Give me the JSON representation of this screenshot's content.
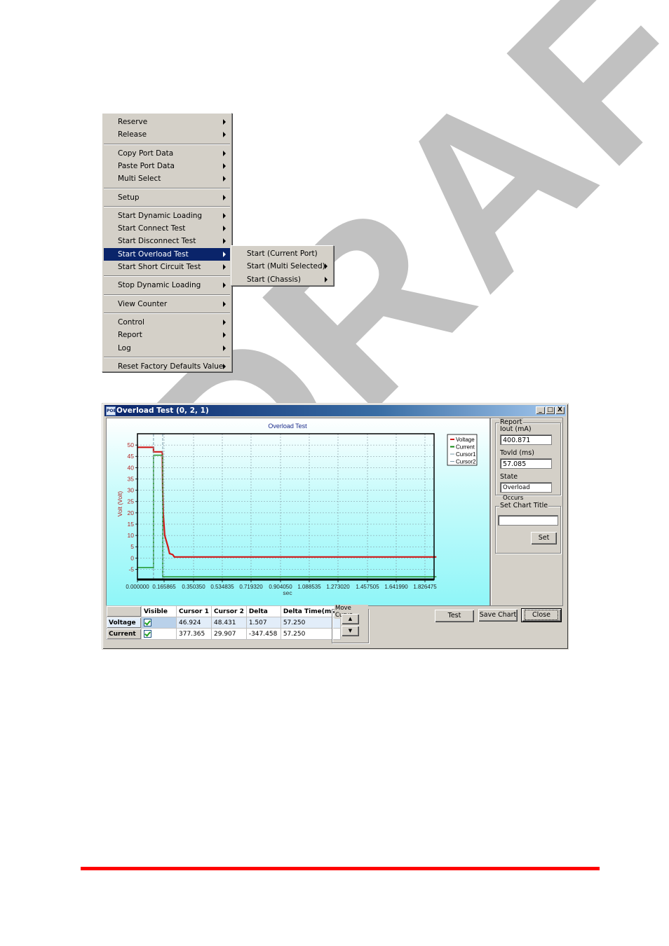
{
  "context_menu": {
    "items": [
      {
        "label": "Reserve",
        "has_submenu": true
      },
      {
        "label": "Release",
        "has_submenu": true
      },
      {
        "separator": true
      },
      {
        "label": "Copy Port Data",
        "has_submenu": true
      },
      {
        "label": "Paste Port Data",
        "has_submenu": true
      },
      {
        "label": "Multi Select",
        "has_submenu": true
      },
      {
        "separator": true
      },
      {
        "label": "Setup",
        "has_submenu": true
      },
      {
        "separator": true
      },
      {
        "label": "Start Dynamic Loading",
        "has_submenu": true
      },
      {
        "label": "Start Connect Test",
        "has_submenu": true
      },
      {
        "label": "Start Disconnect Test",
        "has_submenu": true
      },
      {
        "label": "Start Overload Test",
        "has_submenu": true,
        "active": true
      },
      {
        "label": "Start Short Circuit Test",
        "has_submenu": true
      },
      {
        "separator": true
      },
      {
        "label": "Stop Dynamic Loading",
        "has_submenu": true
      },
      {
        "separator": true
      },
      {
        "label": "View Counter",
        "has_submenu": true
      },
      {
        "separator": true
      },
      {
        "label": "Control",
        "has_submenu": true
      },
      {
        "label": "Report",
        "has_submenu": true
      },
      {
        "label": "Log",
        "has_submenu": true
      },
      {
        "separator": true
      },
      {
        "label": "Reset Factory Defaults Value",
        "has_submenu": true
      }
    ],
    "submenu": [
      {
        "label": "Start (Current Port)",
        "has_submenu": false
      },
      {
        "label": "Start (Multi Selected)",
        "has_submenu": true
      },
      {
        "label": "Start (Chassis)",
        "has_submenu": true
      }
    ]
  },
  "window": {
    "title": "Overload Test (0, 2, 1)",
    "app_icon_text": "POE",
    "controls": {
      "minimize": "_",
      "maximize": "□",
      "close": "X"
    }
  },
  "chart_data": {
    "type": "line",
    "title": "Overload Test",
    "xlabel": "sec",
    "ylabel": "Volt (Volt)",
    "xlim": [
      0.0,
      1.9
    ],
    "ylim": [
      -9.5,
      55
    ],
    "grid": true,
    "legend_position": "right",
    "x_ticks": [
      "0.000000",
      "0.165865",
      "0.350350",
      "0.534835",
      "0.719320",
      "0.904050",
      "1.088535",
      "1.273020",
      "1.457505",
      "1.641990",
      "1.826475"
    ],
    "x_tick_values": [
      0.0,
      0.165865,
      0.35035,
      0.534835,
      0.71932,
      0.90405,
      1.088535,
      1.27302,
      1.457505,
      1.64199,
      1.826475
    ],
    "y_ticks": [
      50,
      45,
      40,
      35,
      30,
      25,
      20,
      15,
      10,
      5,
      0,
      -5
    ],
    "colors": {
      "voltage": "#d01818",
      "current": "#128a12",
      "cursor": "#7a9aa8",
      "grid": "#7d8f99"
    },
    "series": [
      {
        "name": "Voltage",
        "x": [
          0.0,
          0.1,
          0.1,
          0.155,
          0.157,
          0.16,
          0.17,
          0.19,
          0.2,
          0.22,
          0.23,
          1.9
        ],
        "y": [
          49,
          49,
          47,
          47,
          30,
          20,
          10,
          5,
          2,
          1.5,
          0.5,
          0.5
        ]
      },
      {
        "name": "Current",
        "x": [
          0.0,
          0.1,
          0.1,
          0.157,
          0.157,
          1.9
        ],
        "y": [
          -4.2,
          -4.2,
          45.5,
          45.5,
          -8.3,
          -8.3
        ]
      },
      {
        "name": "Cursor1",
        "x": [
          0.1,
          0.1
        ],
        "y": [
          -9.5,
          55
        ]
      },
      {
        "name": "Cursor2",
        "x": [
          0.157,
          0.157
        ],
        "y": [
          -9.5,
          55
        ]
      }
    ]
  },
  "report": {
    "group_label": "Report",
    "iout_label": "Iout (mA)",
    "iout_value": "400.871",
    "tovld_label": "Tovld (ms)",
    "tovld_value": "57.085",
    "state_label": "State",
    "state_value": "Overload Occurs"
  },
  "chart_title_group": {
    "group_label": "Set Chart Title",
    "input_value": "",
    "set_label": "Set"
  },
  "cursor_table": {
    "headers": [
      "",
      "Visible",
      "Cursor 1",
      "Cursor 2",
      "Delta",
      "Delta Time(ms)"
    ],
    "rows": [
      {
        "name": "Voltage",
        "visible": true,
        "cursor1": "46.924",
        "cursor2": "48.431",
        "delta": "1.507",
        "delta_time": "57.250"
      },
      {
        "name": "Current",
        "visible": true,
        "cursor1": "377.365",
        "cursor2": "29.907",
        "delta": "-347.458",
        "delta_time": "57.250"
      }
    ]
  },
  "move_curve": {
    "label": "Move Curve",
    "up": "▲",
    "down": "▼"
  },
  "buttons": {
    "test": "Test",
    "save_chart": "Save Chart",
    "close": "Close"
  },
  "watermark": "DRAFT"
}
